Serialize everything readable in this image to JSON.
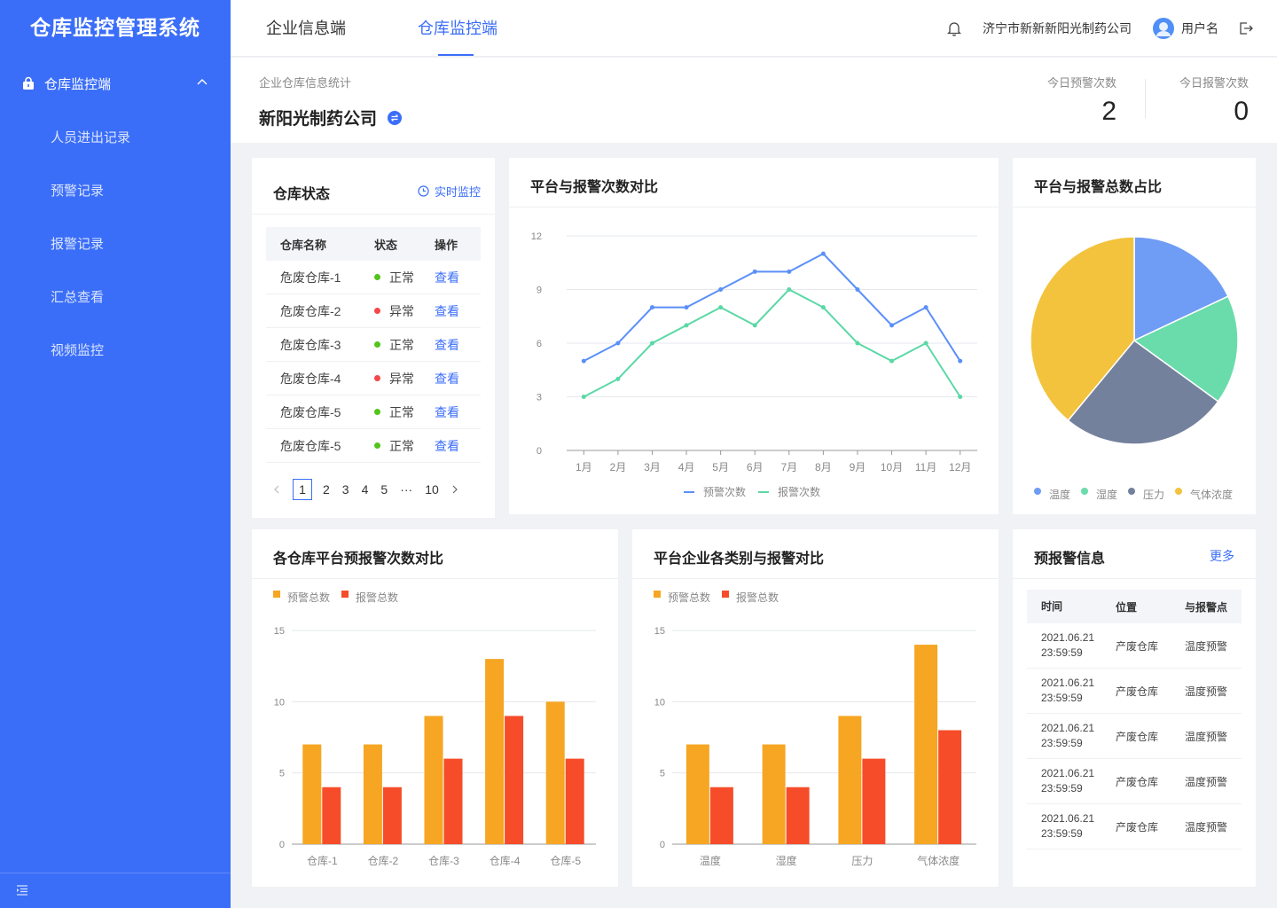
{
  "sidebar": {
    "brand": "仓库监控管理系统",
    "parent": "仓库监控端",
    "items": [
      {
        "label": "人员进出记录"
      },
      {
        "label": "预警记录"
      },
      {
        "label": "报警记录"
      },
      {
        "label": "汇总查看"
      },
      {
        "label": "视频监控"
      }
    ]
  },
  "header": {
    "tabs": [
      {
        "label": "企业信息端"
      },
      {
        "label": "仓库监控端"
      }
    ],
    "company": "济宁市新新新阳光制药公司",
    "username": "用户名"
  },
  "info": {
    "subtitle": "企业仓库信息统计",
    "company": "新阳光制药公司",
    "warn_today_label": "今日预警次数",
    "warn_today_value": "2",
    "alarm_today_label": "今日报警次数",
    "alarm_today_value": "0"
  },
  "warehouse_status": {
    "title": "仓库状态",
    "realtime": "实时监控",
    "columns": [
      "仓库名称",
      "状态",
      "操作"
    ],
    "rows": [
      {
        "name": "危废仓库-1",
        "status": "正常",
        "ok": true,
        "action": "查看"
      },
      {
        "name": "危废仓库-2",
        "status": "异常",
        "ok": false,
        "action": "查看"
      },
      {
        "name": "危废仓库-3",
        "status": "正常",
        "ok": true,
        "action": "查看"
      },
      {
        "name": "危废仓库-4",
        "status": "异常",
        "ok": false,
        "action": "查看"
      },
      {
        "name": "危废仓库-5",
        "status": "正常",
        "ok": true,
        "action": "查看"
      },
      {
        "name": "危废仓库-5",
        "status": "正常",
        "ok": true,
        "action": "查看"
      }
    ],
    "pager": {
      "pages": [
        "1",
        "2",
        "3",
        "4",
        "5",
        "···",
        "10"
      ],
      "current": "1"
    }
  },
  "colors": {
    "primary": "#3b6ef8",
    "ok": "#52c41a",
    "bad": "#f5474b",
    "line_warn": "#5b8ff9",
    "line_alarm": "#5ad8a6",
    "bar_warn": "#f6a623",
    "bar_alarm": "#f64c2a"
  },
  "chart_data": [
    {
      "id": "line",
      "type": "line",
      "title": "平台与报警次数对比",
      "categories": [
        "1月",
        "2月",
        "3月",
        "4月",
        "5月",
        "6月",
        "7月",
        "8月",
        "9月",
        "10月",
        "11月",
        "12月"
      ],
      "series": [
        {
          "name": "预警次数",
          "values": [
            5,
            6,
            8,
            8,
            9,
            10,
            10,
            11,
            9,
            7,
            8,
            5
          ]
        },
        {
          "name": "报警次数",
          "values": [
            3,
            4,
            6,
            7,
            8,
            7,
            9,
            8,
            6,
            5,
            6,
            3
          ]
        }
      ],
      "ylim": [
        0,
        12
      ],
      "yticks": [
        0,
        3,
        6,
        9,
        12
      ],
      "grid": true,
      "legend": "bottom"
    },
    {
      "id": "pie",
      "type": "pie",
      "title": "平台与报警总数占比",
      "labels": [
        "温度",
        "湿度",
        "压力",
        "气体浓度"
      ],
      "values": [
        18,
        17,
        26,
        39
      ],
      "colors": [
        "#6f9cf4",
        "#6adcab",
        "#74819c",
        "#f3c33e"
      ],
      "legend": "bottom"
    },
    {
      "id": "bar1",
      "type": "bar",
      "title": "各仓库平台预报警次数对比",
      "categories": [
        "仓库-1",
        "仓库-2",
        "仓库-3",
        "仓库-4",
        "仓库-5"
      ],
      "series": [
        {
          "name": "预警总数",
          "values": [
            7,
            7,
            9,
            13,
            10
          ]
        },
        {
          "name": "报警总数",
          "values": [
            4,
            4,
            6,
            9,
            6
          ]
        }
      ],
      "ylim": [
        0,
        15
      ],
      "yticks": [
        0,
        5,
        10,
        15
      ],
      "legend": "top-left"
    },
    {
      "id": "bar2",
      "type": "bar",
      "title": "平台企业各类别与报警对比",
      "categories": [
        "温度",
        "湿度",
        "压力",
        "气体浓度"
      ],
      "series": [
        {
          "name": "预警总数",
          "values": [
            7,
            7,
            9,
            14
          ]
        },
        {
          "name": "报警总数",
          "values": [
            4,
            4,
            6,
            8
          ]
        }
      ],
      "ylim": [
        0,
        15
      ],
      "yticks": [
        0,
        5,
        10,
        15
      ],
      "legend": "top-left"
    }
  ],
  "alerts": {
    "title": "预报警信息",
    "more": "更多",
    "columns": [
      "时间",
      "位置",
      "与报警点"
    ],
    "rows": [
      {
        "date": "2021.06.21",
        "time": "23:59:59",
        "location": "产废仓库",
        "type": "温度预警"
      },
      {
        "date": "2021.06.21",
        "time": "23:59:59",
        "location": "产废仓库",
        "type": "温度预警"
      },
      {
        "date": "2021.06.21",
        "time": "23:59:59",
        "location": "产废仓库",
        "type": "温度预警"
      },
      {
        "date": "2021.06.21",
        "time": "23:59:59",
        "location": "产废仓库",
        "type": "温度预警"
      },
      {
        "date": "2021.06.21",
        "time": "23:59:59",
        "location": "产废仓库",
        "type": "温度预警"
      }
    ]
  }
}
